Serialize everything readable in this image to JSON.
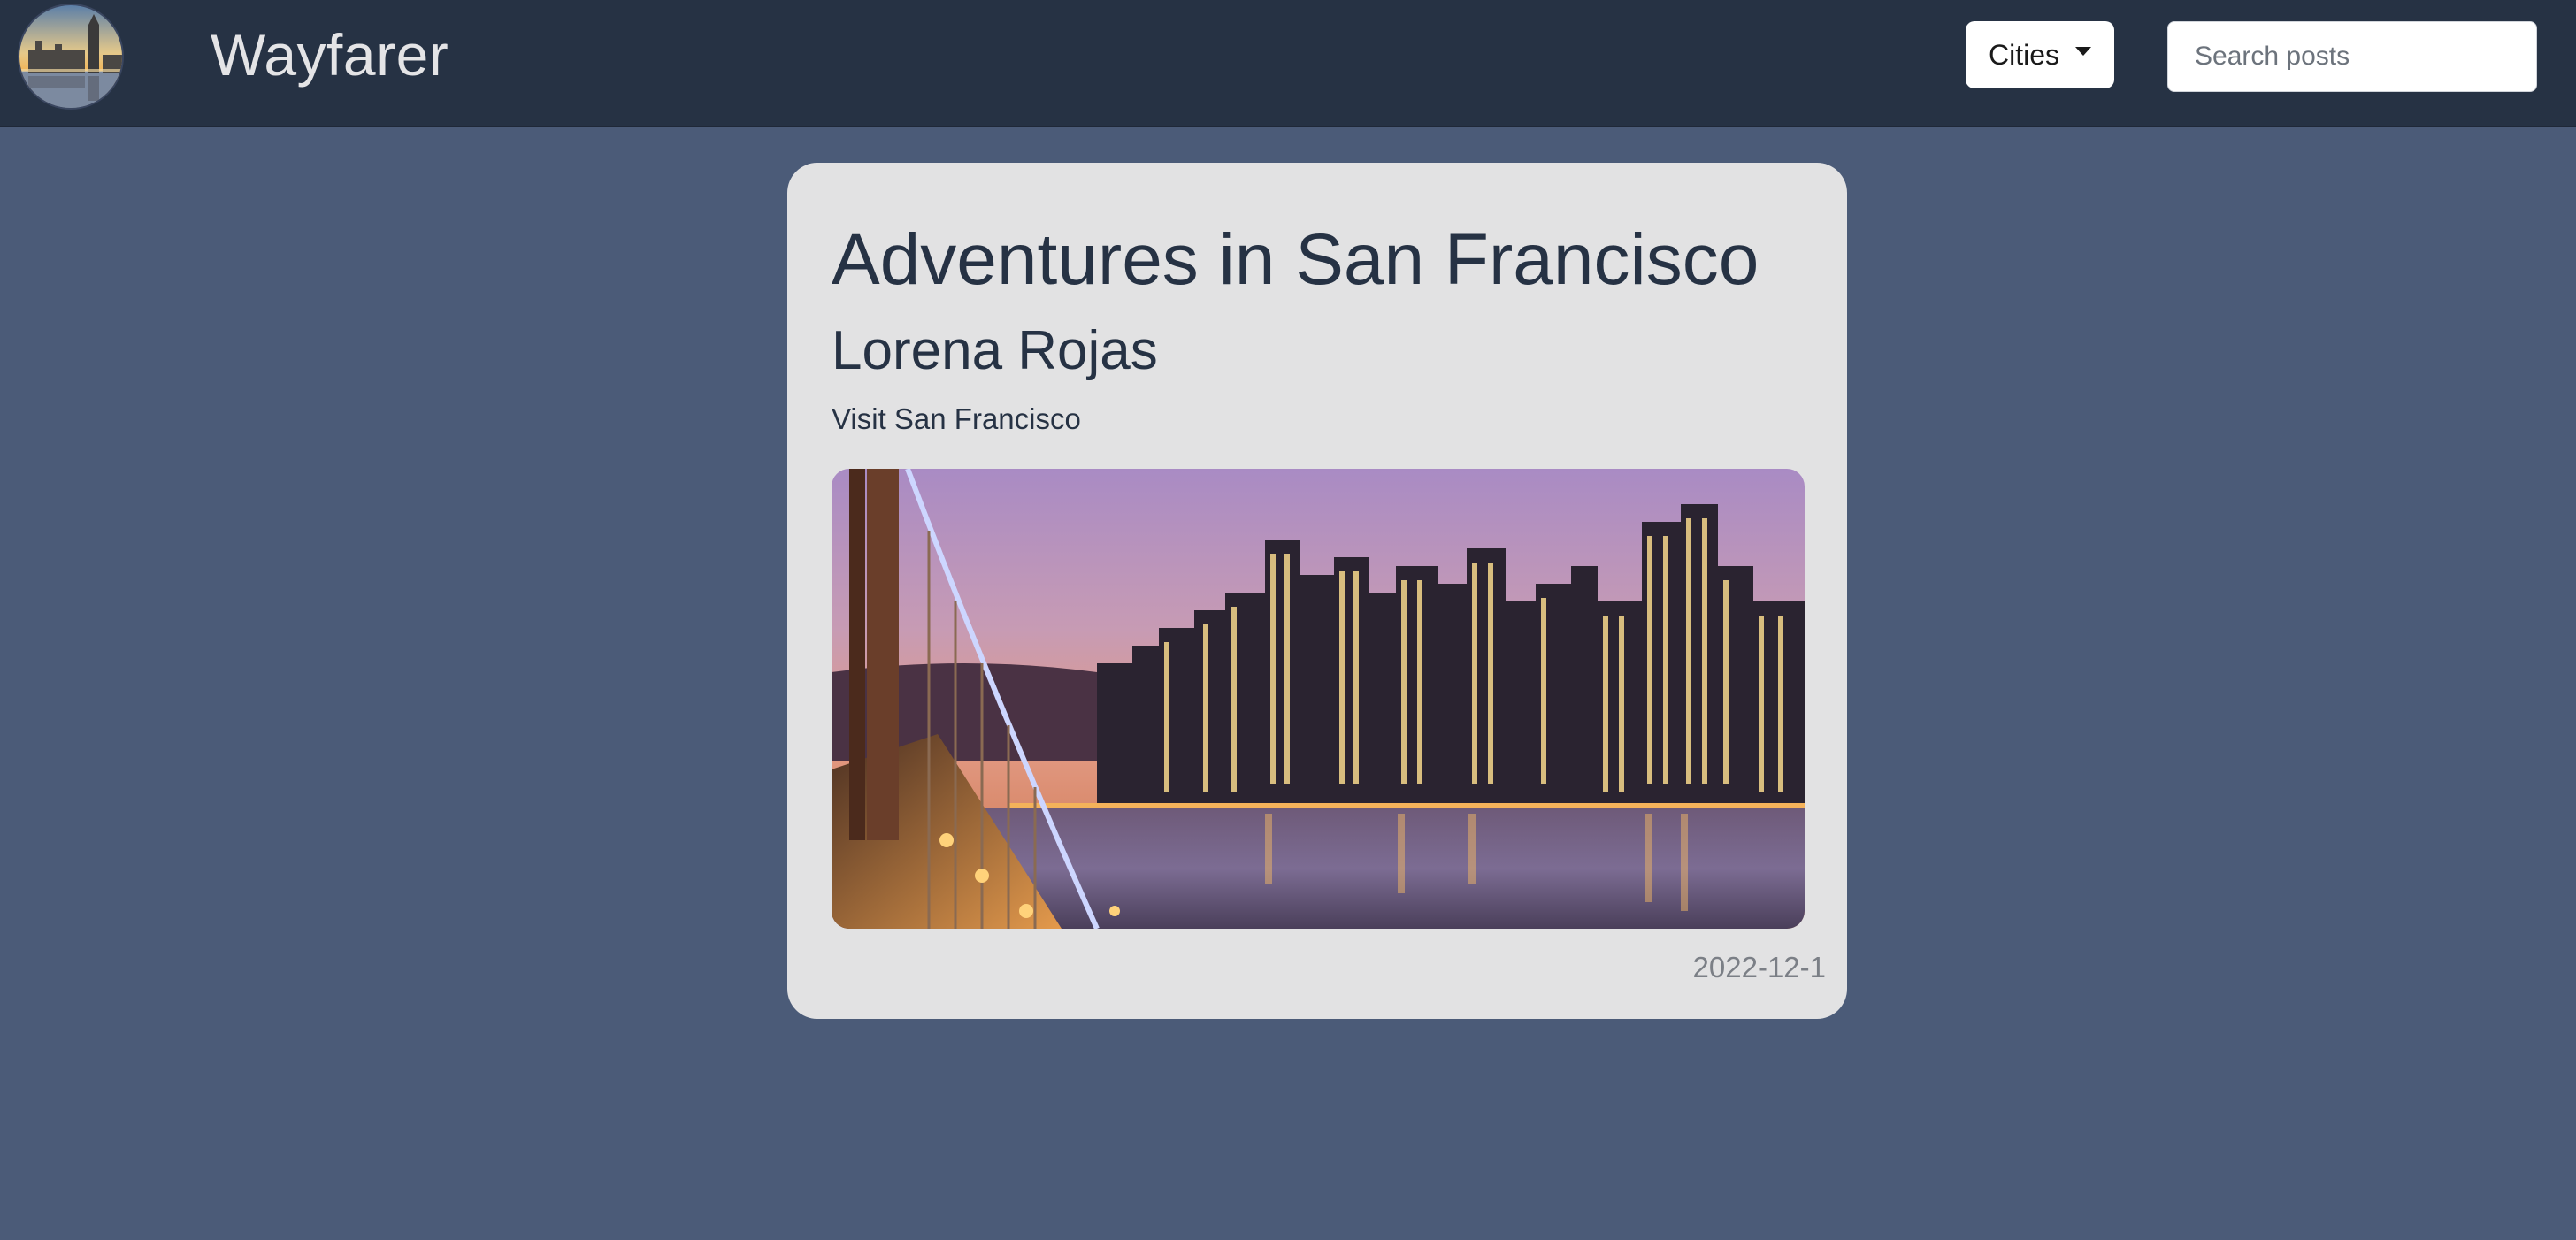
{
  "navbar": {
    "brand": "Wayfarer",
    "logo_icon": "city-skyline-logo",
    "cities_label": "Cities",
    "search_placeholder": "Search posts"
  },
  "post": {
    "title": "Adventures in San Francisco",
    "author": "Lorena Rojas",
    "subtitle": "Visit San Francisco",
    "image_icon": "san-francisco-skyline-photo",
    "date": "2022-12-1"
  },
  "colors": {
    "navbar_bg": "#263244",
    "page_bg": "#4b5b78",
    "card_bg": "#e2e2e3",
    "title_text": "#263244",
    "date_text": "#7b7f86"
  }
}
